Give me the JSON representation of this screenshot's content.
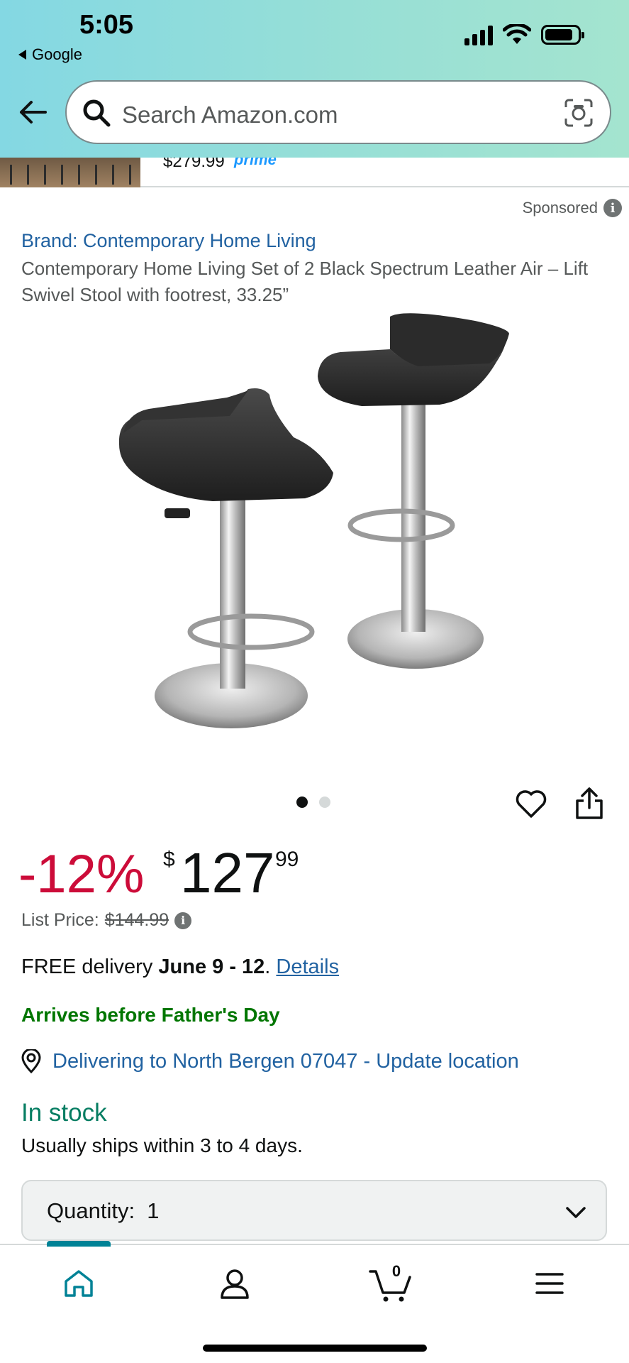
{
  "status_bar": {
    "time": "5:05",
    "back_app": "Google"
  },
  "search": {
    "placeholder": "Search Amazon.com"
  },
  "banner": {
    "price": "$279.99",
    "prime": "prime"
  },
  "sponsored": {
    "label": "Sponsored"
  },
  "product": {
    "brand": "Brand: Contemporary Home Living",
    "title": "Contemporary Home Living Set of 2 Black Spectrum Leather Air – Lift Swivel Stool with footrest, 33.25”",
    "image_dots": 2,
    "active_dot": 1
  },
  "pricing": {
    "discount": "-12%",
    "currency": "$",
    "whole": "127",
    "fraction": "99",
    "list_price_label": "List Price:",
    "list_price_value": "$144.99"
  },
  "delivery": {
    "prefix": "FREE delivery ",
    "dates": "June 9 - 12",
    "separator": ". ",
    "details_link": "Details",
    "promo": "Arrives before Father's Day",
    "location": "Delivering to North Bergen 07047 - Update location"
  },
  "availability": {
    "status": "In stock",
    "ships": "Usually ships within 3 to 4 days."
  },
  "quantity": {
    "label": "Quantity:",
    "value": "1"
  },
  "bottom_nav": {
    "cart_count": "0"
  },
  "colors": {
    "accent": "#008296",
    "link": "#2162a1",
    "discount": "#cc0c39",
    "in_stock": "#067d62",
    "promo": "#007600"
  }
}
